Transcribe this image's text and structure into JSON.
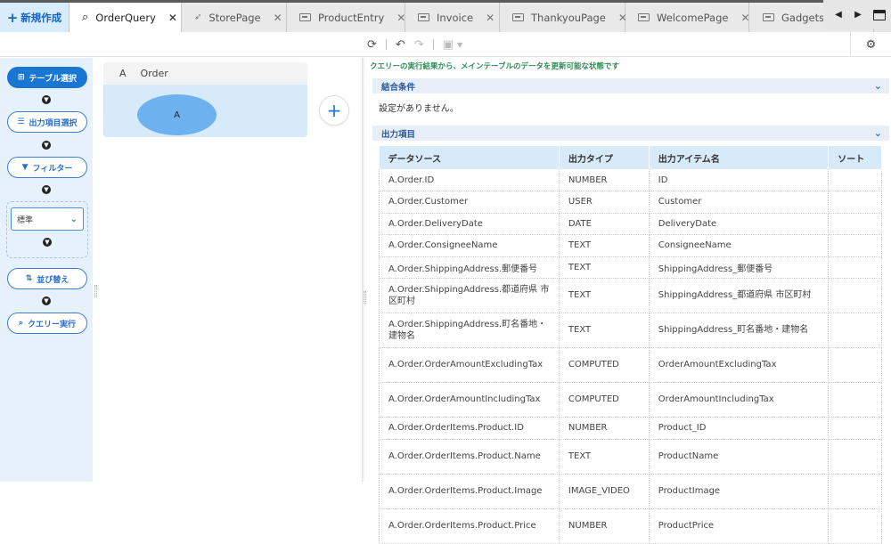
{
  "tabs": {
    "new_label": "新規作成",
    "items": [
      {
        "label": "OrderQuery",
        "active": true,
        "icon": "search-icon"
      },
      {
        "label": "StorePage",
        "active": false,
        "icon": "rocket-icon"
      },
      {
        "label": "ProductEntry",
        "active": false,
        "icon": "form-icon"
      },
      {
        "label": "Invoice",
        "active": false,
        "icon": "form-icon"
      },
      {
        "label": "ThankyouPage",
        "active": false,
        "icon": "form-icon"
      },
      {
        "label": "WelcomePage",
        "active": false,
        "icon": "form-icon"
      },
      {
        "label": "GadgetsSto",
        "active": false,
        "icon": "form-icon"
      }
    ]
  },
  "steps": {
    "table_select": "テーブル選択",
    "output_select": "出力項目選択",
    "filter": "フィルター",
    "standard": "標準",
    "sort": "並び替え",
    "run_query": "クエリー実行"
  },
  "canvas": {
    "table_alias": "A",
    "table_name": "Order",
    "node_label": "A"
  },
  "results": {
    "notice": "クエリーの実行結果から、メインテーブルのデータを更新可能な状態です",
    "join_title": "結合条件",
    "no_setting": "設定がありません。",
    "output_title": "出力項目",
    "columns": [
      "データソース",
      "出力タイプ",
      "出力アイテム名",
      "ソート"
    ],
    "rows": [
      {
        "source": "A.Order.ID",
        "type": "NUMBER",
        "name": "ID",
        "sort": ""
      },
      {
        "source": "A.Order.Customer",
        "type": "USER",
        "name": "Customer",
        "sort": ""
      },
      {
        "source": "A.Order.DeliveryDate",
        "type": "DATE",
        "name": "DeliveryDate",
        "sort": ""
      },
      {
        "source": "A.Order.ConsigneeName",
        "type": "TEXT",
        "name": "ConsigneeName",
        "sort": ""
      },
      {
        "source": "A.Order.ShippingAddress.郵便番号",
        "type": "TEXT",
        "name": "ShippingAddress_郵便番号",
        "sort": ""
      },
      {
        "source": "A.Order.ShippingAddress.都道府県 市区町村",
        "type": "TEXT",
        "name": "ShippingAddress_都道府県 市区町村",
        "sort": ""
      },
      {
        "source": "A.Order.ShippingAddress.町名番地・建物名",
        "type": "TEXT",
        "name": "ShippingAddress_町名番地・建物名",
        "sort": ""
      },
      {
        "source": "A.Order.OrderAmountExcludingTax",
        "type": "COMPUTED",
        "name": "OrderAmountExcludingTax",
        "sort": ""
      },
      {
        "source": "A.Order.OrderAmountIncludingTax",
        "type": "COMPUTED",
        "name": "OrderAmountIncludingTax",
        "sort": ""
      },
      {
        "source": "A.Order.OrderItems.Product.ID",
        "type": "NUMBER",
        "name": "Product_ID",
        "sort": ""
      },
      {
        "source": "A.Order.OrderItems.Product.Name",
        "type": "TEXT",
        "name": "ProductName",
        "sort": ""
      },
      {
        "source": "A.Order.OrderItems.Product.Image",
        "type": "IMAGE_VIDEO",
        "name": "ProductImage",
        "sort": ""
      },
      {
        "source": "A.Order.OrderItems.Product.Price",
        "type": "NUMBER",
        "name": "ProductPrice",
        "sort": ""
      }
    ]
  },
  "colors": {
    "accent": "#1976d2",
    "panel_bg": "#e6f1fc",
    "notice_green": "#2e8b57"
  }
}
